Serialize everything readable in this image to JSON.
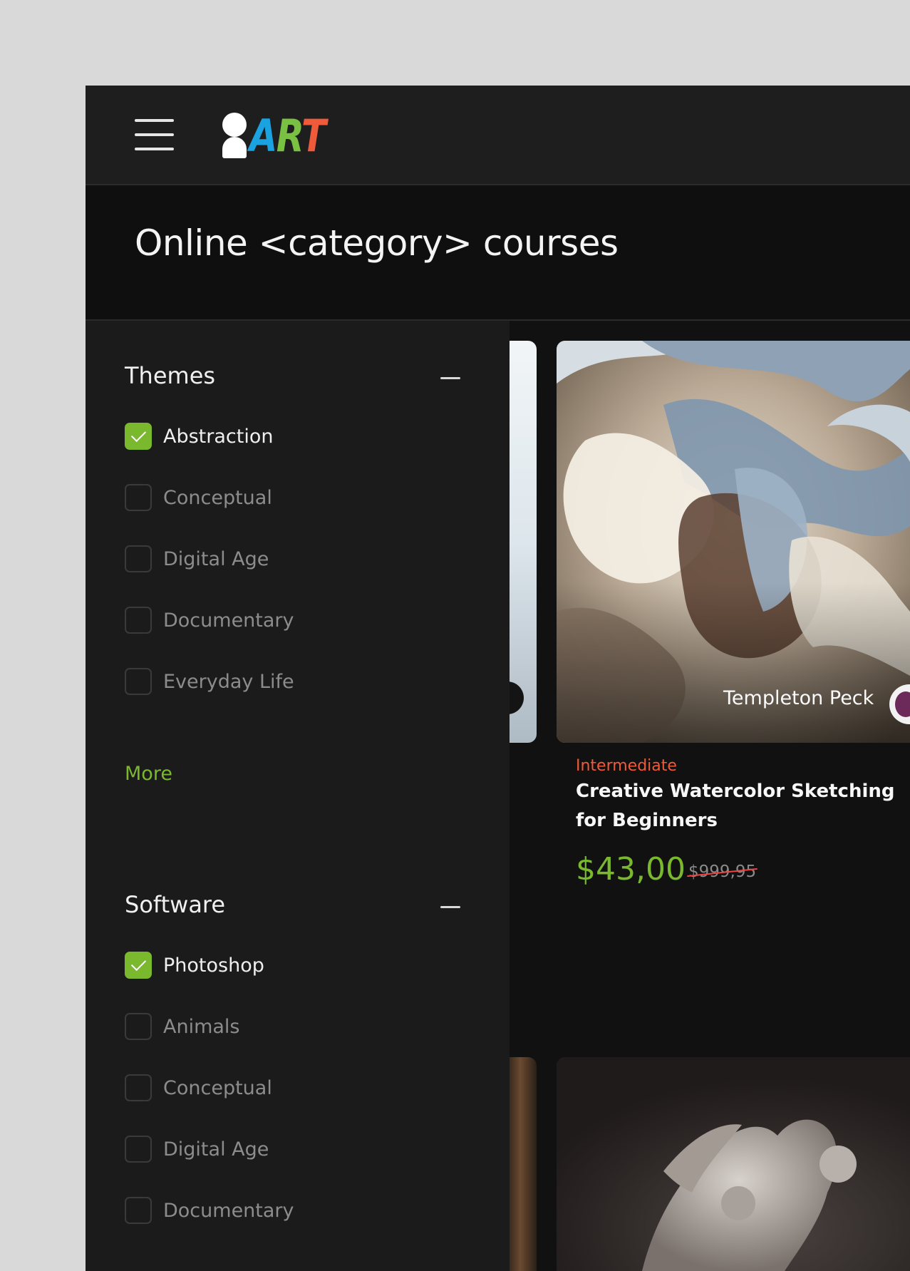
{
  "header": {
    "menu_icon": "hamburger-icon",
    "logo_text": "ART"
  },
  "page": {
    "title": "Online <category> courses"
  },
  "filters": {
    "themes": {
      "title": "Themes",
      "collapse_icon": "minus-icon",
      "options": [
        {
          "label": "Abstraction",
          "checked": true
        },
        {
          "label": "Conceptual",
          "checked": false
        },
        {
          "label": "Digital Age",
          "checked": false
        },
        {
          "label": "Documentary",
          "checked": false
        },
        {
          "label": "Everyday Life",
          "checked": false
        }
      ],
      "more_label": "More"
    },
    "software": {
      "title": "Software",
      "collapse_icon": "minus-icon",
      "options": [
        {
          "label": "Photoshop",
          "checked": true
        },
        {
          "label": "Animals",
          "checked": false
        },
        {
          "label": "Conceptual",
          "checked": false
        },
        {
          "label": "Digital Age",
          "checked": false
        },
        {
          "label": "Documentary",
          "checked": false
        }
      ]
    }
  },
  "course_card": {
    "author": "Templeton Peck",
    "level": "Intermediate",
    "title": "Creative Watercolor Sketching for Beginners",
    "price": "$43,00",
    "old_price": "$999,95"
  },
  "colors": {
    "accent_green": "#7ab82e",
    "accent_orange": "#ef5a3a",
    "logo_blue": "#1aa3e0",
    "logo_green": "#7ac143",
    "logo_red": "#ef5a3a"
  }
}
